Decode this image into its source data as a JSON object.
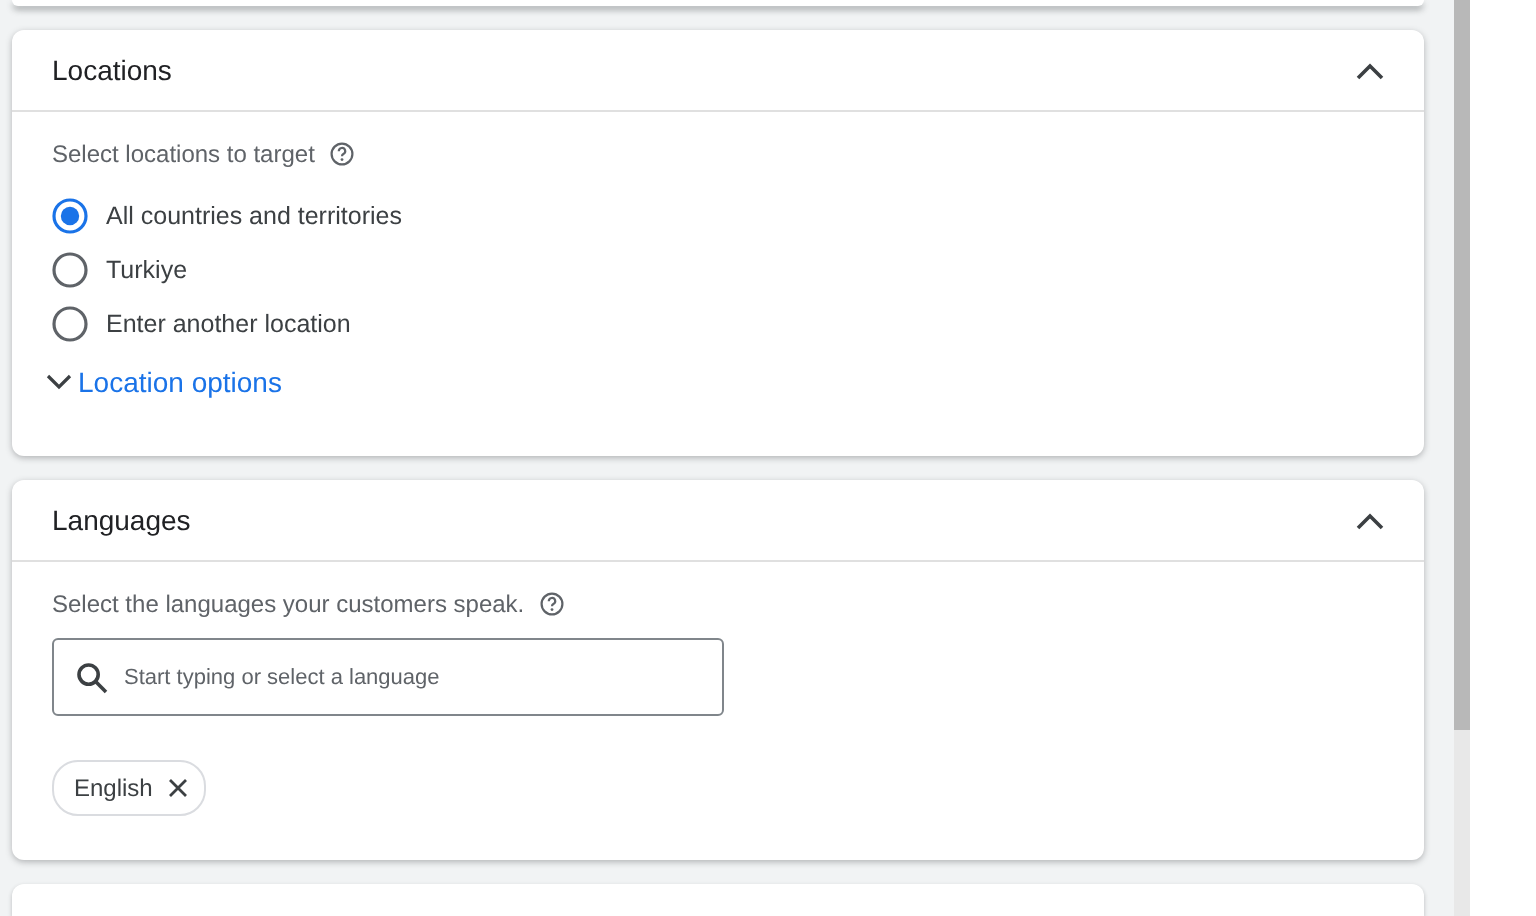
{
  "locations": {
    "title": "Locations",
    "expanded": true,
    "prompt": "Select locations to target",
    "options": [
      {
        "label": "All countries and territories",
        "selected": true
      },
      {
        "label": "Turkiye",
        "selected": false
      },
      {
        "label": "Enter another location",
        "selected": false
      }
    ],
    "more": {
      "label": "Location options",
      "expanded": false
    }
  },
  "languages": {
    "title": "Languages",
    "expanded": true,
    "prompt": "Select the languages your customers speak.",
    "search": {
      "placeholder": "Start typing or select a language"
    },
    "chips": [
      {
        "label": "English"
      }
    ]
  }
}
